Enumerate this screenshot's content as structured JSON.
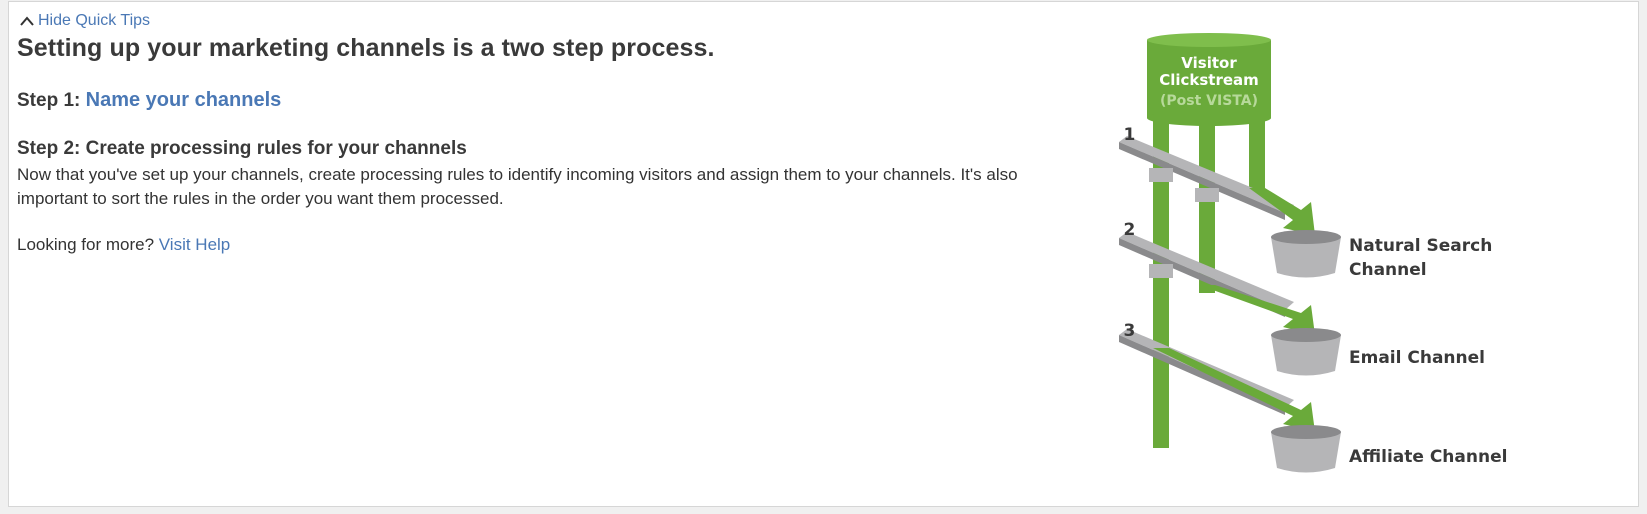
{
  "quick_tips": {
    "toggle_label": "Hide Quick Tips",
    "toggle_icon": "chevron-up-icon"
  },
  "content": {
    "heading": "Setting up your marketing channels is a two step process.",
    "step1_prefix": "Step 1:",
    "step1_link": "Name your channels",
    "step2_heading": "Step 2: Create processing rules for your channels",
    "step2_description": "Now that you've set up your channels, create processing rules to identify incoming visitors and assign them to your channels. It's also important to sort the rules in the order you want them processed.",
    "more_prefix": "Looking for more?",
    "more_link": "Visit Help"
  },
  "diagram": {
    "source_line1": "Visitor",
    "source_line2": "Clickstream",
    "source_line3": "(Post VISTA)",
    "rules": [
      "Rule 1",
      "Rule 2",
      "Rule 3"
    ],
    "channels": [
      {
        "line1": "Natural Search",
        "line2": "Channel"
      },
      {
        "line1": "Email Channel",
        "line2": ""
      },
      {
        "line1": "Affiliate Channel",
        "line2": ""
      }
    ],
    "colors": {
      "green": "#6aaa3a",
      "green_dark": "#4f8a2a",
      "gray": "#b5b5b7",
      "gray_dark": "#8a8a8c",
      "text": "#3a3a3a",
      "link": "#4a78b5"
    }
  }
}
